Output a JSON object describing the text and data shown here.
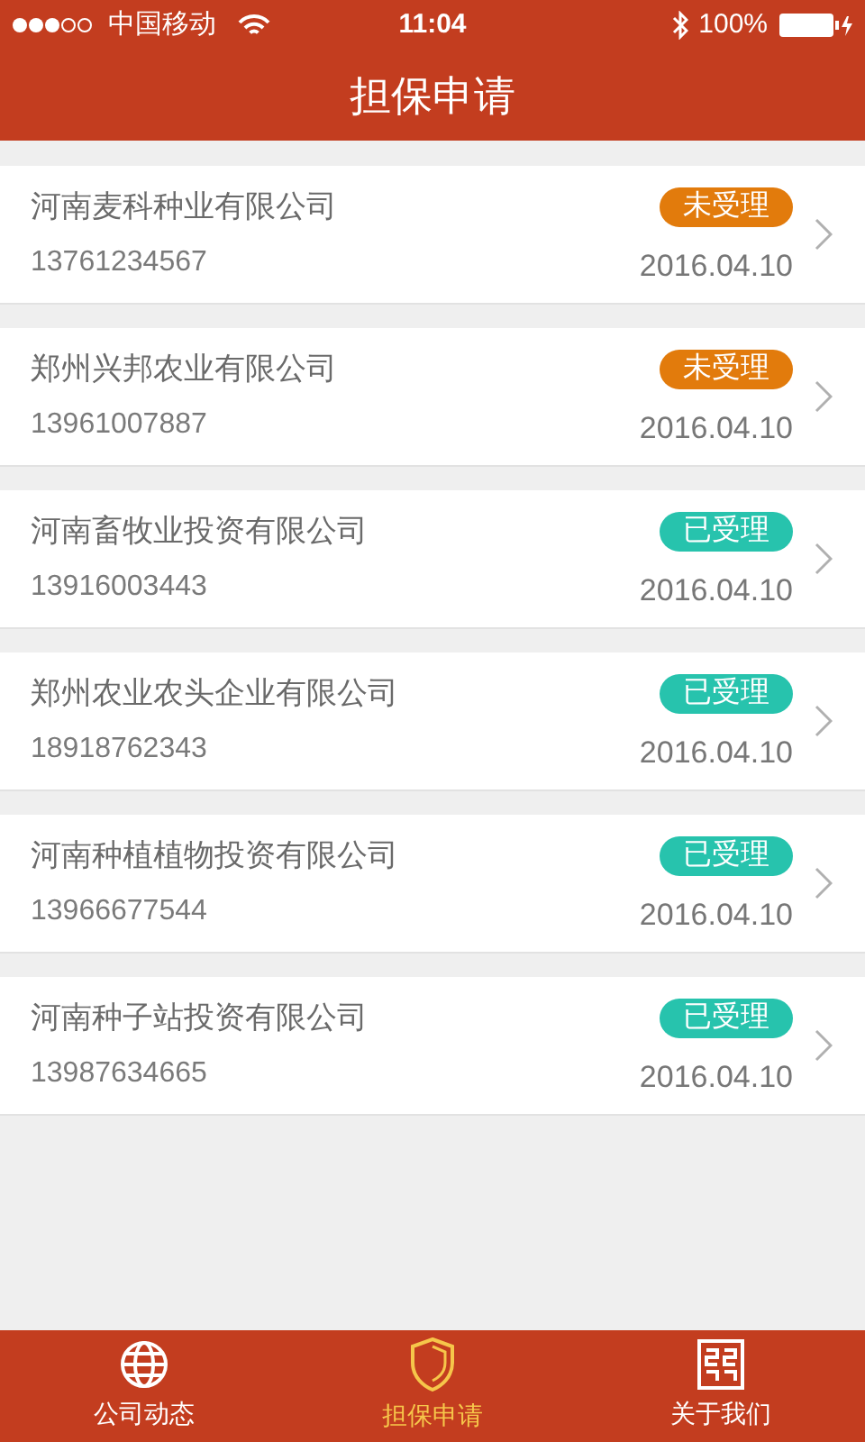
{
  "status_bar": {
    "carrier": "中国移动",
    "time": "11:04",
    "battery": "100%"
  },
  "header": {
    "title": "担保申请"
  },
  "applications": [
    {
      "company": "河南麦科种业有限公司",
      "phone": "13761234567",
      "status": {
        "label": "未受理",
        "kind": "pending"
      },
      "date": "2016.04.10"
    },
    {
      "company": "郑州兴邦农业有限公司",
      "phone": "13961007887",
      "status": {
        "label": "未受理",
        "kind": "pending"
      },
      "date": "2016.04.10"
    },
    {
      "company": "河南畜牧业投资有限公司",
      "phone": "13916003443",
      "status": {
        "label": "已受理",
        "kind": "accepted"
      },
      "date": "2016.04.10"
    },
    {
      "company": "郑州农业农头企业有限公司",
      "phone": "18918762343",
      "status": {
        "label": "已受理",
        "kind": "accepted"
      },
      "date": "2016.04.10"
    },
    {
      "company": "河南种植植物投资有限公司",
      "phone": "13966677544",
      "status": {
        "label": "已受理",
        "kind": "accepted"
      },
      "date": "2016.04.10"
    },
    {
      "company": "河南种子站投资有限公司",
      "phone": "13987634665",
      "status": {
        "label": "已受理",
        "kind": "accepted"
      },
      "date": "2016.04.10"
    }
  ],
  "tab_bar": [
    {
      "label": "公司动态",
      "kind": "globe",
      "selected": false
    },
    {
      "label": "担保申请",
      "kind": "shield",
      "selected": true
    },
    {
      "label": "关于我们",
      "kind": "pattern",
      "selected": false
    }
  ]
}
